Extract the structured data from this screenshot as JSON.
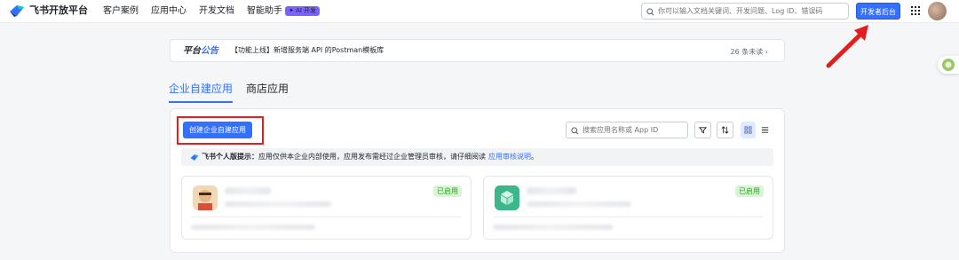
{
  "topnav": {
    "logo_text": "飞书开放平台",
    "links": [
      "客户案例",
      "应用中心",
      "开发文档",
      "智能助手"
    ],
    "ai_badge": "✦ AI 开发",
    "search_placeholder": "你可以输入文档关键词、开发问题、Log ID、错误码",
    "dev_console_button": "开发者后台"
  },
  "notice": {
    "tag_part1": "平台",
    "tag_part2": "公告",
    "text": "【功能上线】新增服务端 API 的Postman模板库",
    "unread": "26 条未读 ›"
  },
  "tabs": [
    {
      "label": "企业自建应用",
      "active": true
    },
    {
      "label": "商店应用",
      "active": false
    }
  ],
  "panel": {
    "create_button": "创建企业自建应用",
    "search_placeholder": "搜索应用名称或 App ID",
    "tip_title": "飞书个人版提示：",
    "tip_text": "应用仅供本企业内部使用，应用发布需经过企业管理员审核，请仔细阅读",
    "tip_link": "应用审核说明",
    "tip_end": "。"
  },
  "cards": [
    {
      "status": "已启用"
    },
    {
      "status": "已启用"
    }
  ],
  "colors": {
    "primary": "#3370ff",
    "highlight_red": "#e41e1e",
    "enabled_green": "#2ea121"
  }
}
